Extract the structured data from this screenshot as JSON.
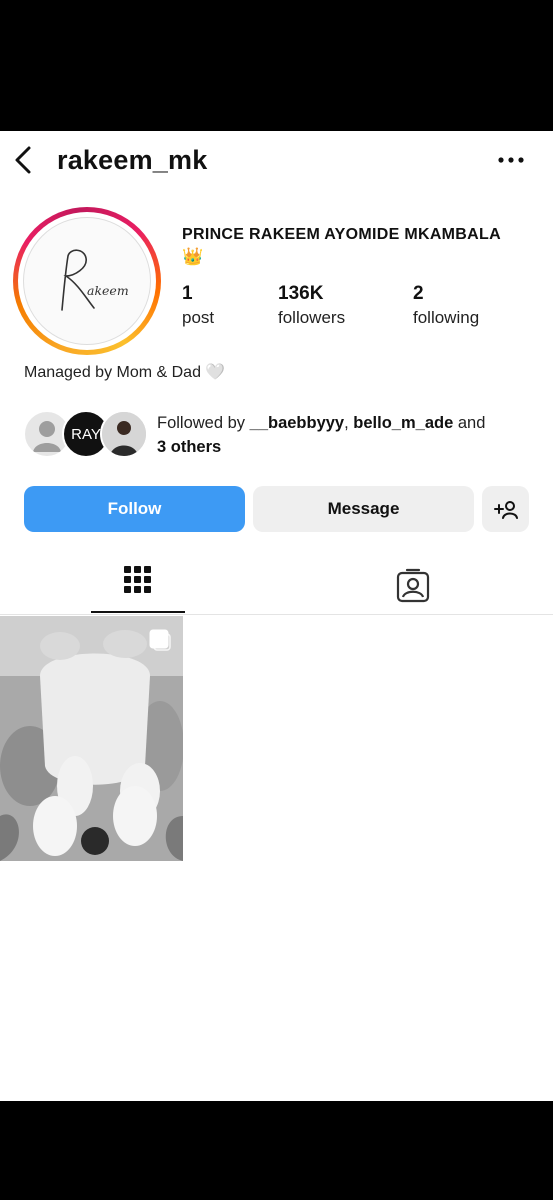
{
  "header": {
    "username": "rakeem_mk",
    "back_icon": "chevron-left-icon",
    "more_icon": "more-horizontal-icon"
  },
  "profile": {
    "avatar_text": "Rakeem",
    "full_name": "PRINCE RAKEEM AYOMIDE MKAMBALA",
    "crown_emoji": "👑",
    "stats": {
      "posts": {
        "value": "1",
        "label": "post"
      },
      "followers": {
        "value": "136K",
        "label": "followers"
      },
      "following": {
        "value": "2",
        "label": "following"
      }
    },
    "bio": "Managed by Mom & Dad 🤍"
  },
  "followed_by": {
    "prefix": "Followed by ",
    "user1": "__baebbyyy",
    "sep": ", ",
    "user2": "bello_m_ade",
    "and": " and",
    "others": "3 others",
    "avatar2_text": "RAY"
  },
  "actions": {
    "follow_label": "Follow",
    "message_label": "Message",
    "add_icon": "add-person-icon"
  },
  "tabs": {
    "grid_icon": "grid-icon",
    "tagged_icon": "tagged-person-icon"
  },
  "colors": {
    "follow_button": "#3d9af4",
    "secondary_button": "#efefef"
  }
}
